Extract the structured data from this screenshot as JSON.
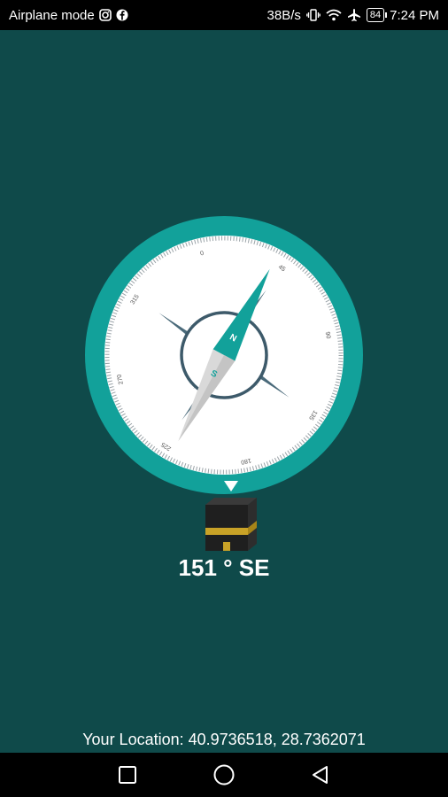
{
  "status_bar": {
    "left_text": "Airplane mode",
    "speed": "38B/s",
    "battery": "84",
    "time": "7:24 PM",
    "icons": [
      "instagram-icon",
      "facebook-icon",
      "vibrate-icon",
      "wifi-icon",
      "airplane-icon",
      "battery-icon"
    ]
  },
  "compass": {
    "heading_text": "151 ° SE",
    "dial_labels": [
      "0",
      "45",
      "90",
      "135",
      "180",
      "225",
      "270",
      "315"
    ],
    "needle_north": "N",
    "needle_south": "S",
    "heading_degrees": 151,
    "needle_bearing_degrees": 28,
    "colors": {
      "ring": "#12a19a",
      "background": "#0f4a4a",
      "face": "#ffffff",
      "rose": "#3d5a6a"
    }
  },
  "location": {
    "text": "Your Location: 40.9736518, 28.7362071"
  },
  "nav": {
    "icons": [
      "recent-apps-icon",
      "home-icon",
      "back-icon"
    ]
  }
}
